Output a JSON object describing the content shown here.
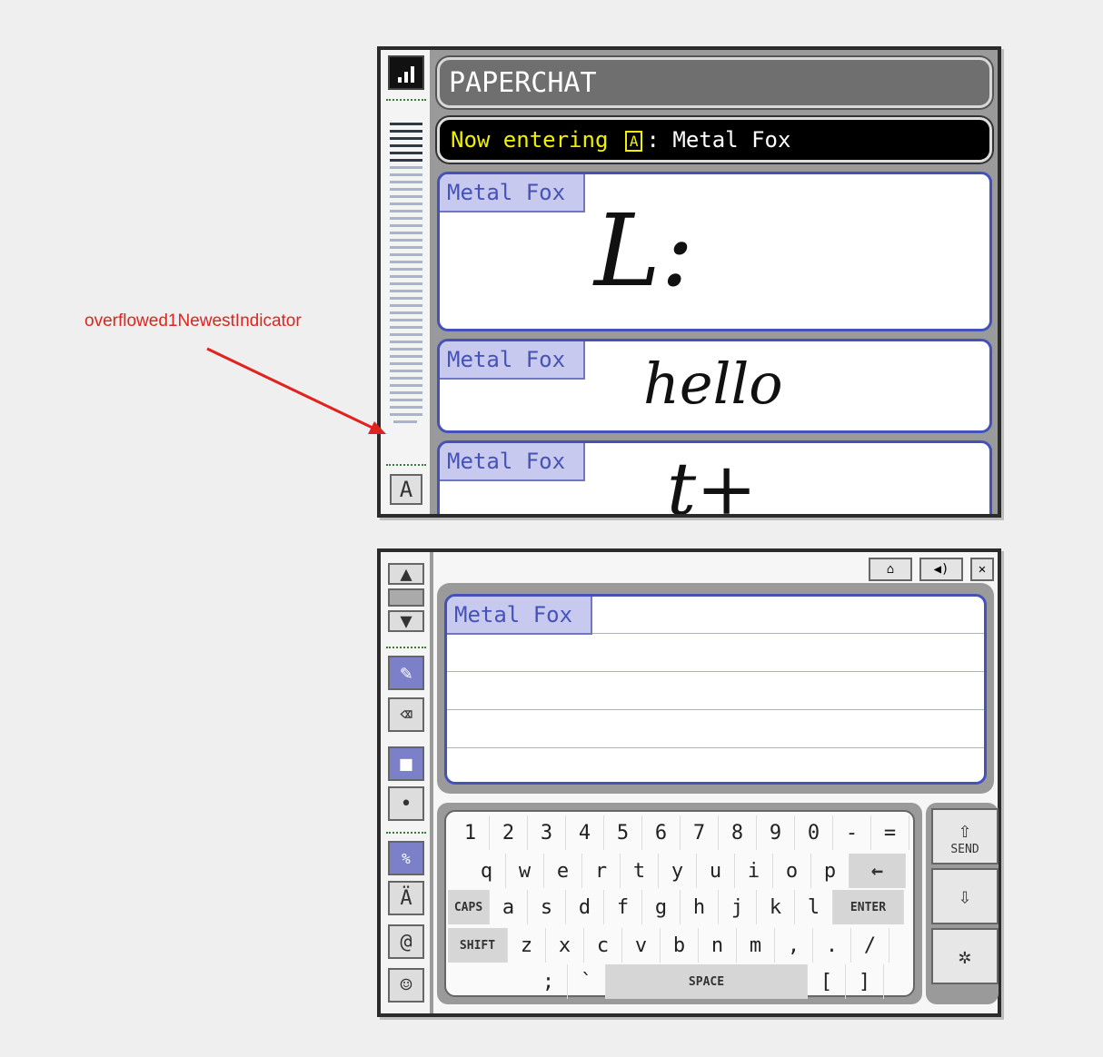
{
  "annotation": {
    "label": "overflowed1NewestIndicator"
  },
  "top": {
    "title": "PAPERCHAT",
    "entering_prefix": "Now entering",
    "entering_room": "A",
    "entering_user": ": Metal Fox",
    "messages": [
      {
        "user": "Metal Fox",
        "text": "L:"
      },
      {
        "user": "Metal Fox",
        "text": "hello"
      },
      {
        "user": "Metal Fox",
        "text": "t+"
      }
    ],
    "side_button": "A"
  },
  "bottom": {
    "compose_user": "Metal Fox",
    "keyboard": {
      "row1": [
        "1",
        "2",
        "3",
        "4",
        "5",
        "6",
        "7",
        "8",
        "9",
        "0",
        "-",
        "="
      ],
      "row2": [
        "q",
        "w",
        "e",
        "r",
        "t",
        "y",
        "u",
        "i",
        "o",
        "p",
        "←"
      ],
      "row3": [
        "CAPS",
        "a",
        "s",
        "d",
        "f",
        "g",
        "h",
        "j",
        "k",
        "l",
        "ENTER"
      ],
      "row4": [
        "SHIFT",
        "z",
        "x",
        "c",
        "v",
        "b",
        "n",
        "m",
        ",",
        ".",
        "/"
      ],
      "row5": [
        ";",
        "`",
        "SPACE",
        "[",
        "]"
      ]
    },
    "send_label": "SEND"
  },
  "colors": {
    "accent": "#4452b8",
    "name_bg": "#c7c9ee",
    "frame": "#9a9a9a",
    "yellow": "#f0f000"
  },
  "icons": [
    "signal-icon",
    "pencil-icon",
    "eraser-icon",
    "scroll-up-icon",
    "scroll-down-icon",
    "at-icon",
    "smiley-icon",
    "mute-icon",
    "close-icon"
  ]
}
